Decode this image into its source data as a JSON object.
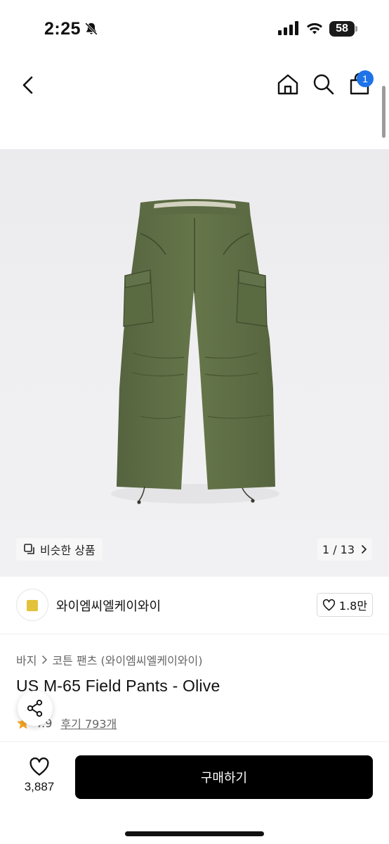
{
  "status_bar": {
    "time": "2:25",
    "battery": "58"
  },
  "nav": {
    "cart_count": "1"
  },
  "gallery": {
    "similar_label": "비슷한 상품",
    "page_indicator": "1 / 13"
  },
  "brand": {
    "name": "와이엠씨엘케이와이",
    "likes": "1.8만"
  },
  "breadcrumb": [
    "바지",
    "코튼 팬츠 (와이엠씨엘케이와이)"
  ],
  "product": {
    "title": "US M-65 Field Pants - Olive",
    "rating": "4.9",
    "reviews": "후기 793개"
  },
  "bottom": {
    "wish_count": "3,887",
    "buy_label": "구매하기"
  },
  "colors": {
    "accent_blue": "#1e73e8",
    "olive": "#5f6f45",
    "star": "#f5a623"
  }
}
